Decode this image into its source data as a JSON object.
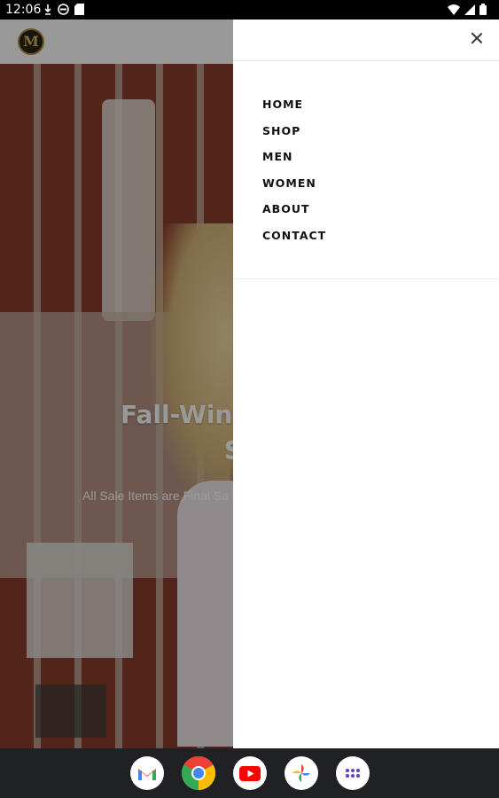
{
  "status_bar": {
    "time": "12:06"
  },
  "site": {
    "logo_letter": "M"
  },
  "hero": {
    "title_line1": "Fall-Wint",
    "title_line2": "S",
    "subtitle": "All Sale Items are Final Sa"
  },
  "drawer": {
    "menu": [
      {
        "label": "HOME"
      },
      {
        "label": "SHOP"
      },
      {
        "label": "MEN"
      },
      {
        "label": "WOMEN"
      },
      {
        "label": "ABOUT"
      },
      {
        "label": "CONTACT"
      }
    ]
  },
  "dock": {
    "apps": [
      {
        "icon": "gmail-icon"
      },
      {
        "icon": "chrome-icon"
      },
      {
        "icon": "youtube-icon"
      },
      {
        "icon": "photos-icon"
      },
      {
        "icon": "app-drawer-icon"
      }
    ]
  },
  "colors": {
    "drawer_bg": "#ffffff",
    "overlay": "rgba(0,0,0,0.40)",
    "navbar_bg": "#1f2124"
  }
}
